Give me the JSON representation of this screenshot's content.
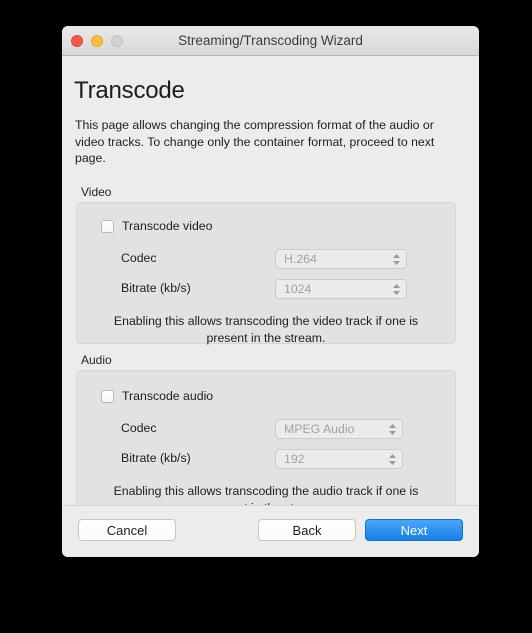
{
  "window": {
    "title": "Streaming/Transcoding Wizard",
    "controls": {
      "close": "close-button",
      "minimize": "minimize-button",
      "zoom": "zoom-button"
    }
  },
  "page": {
    "title": "Transcode",
    "description": "This page allows changing the compression format of the audio or video tracks. To change only the container format, proceed to next page."
  },
  "video": {
    "group_label": "Video",
    "checkbox_label": "Transcode video",
    "checked": false,
    "codec": {
      "label": "Codec",
      "value": "H.264"
    },
    "bitrate": {
      "label": "Bitrate (kb/s)",
      "value": "1024"
    },
    "hint": "Enabling this allows transcoding the video track if one is present in the stream."
  },
  "audio": {
    "group_label": "Audio",
    "checkbox_label": "Transcode audio",
    "checked": false,
    "codec": {
      "label": "Codec",
      "value": "MPEG Audio"
    },
    "bitrate": {
      "label": "Bitrate (kb/s)",
      "value": "192"
    },
    "hint": "Enabling this allows transcoding the audio track if one is present in the stream."
  },
  "footer": {
    "cancel_label": "Cancel",
    "back_label": "Back",
    "next_label": "Next"
  },
  "colors": {
    "accent": "#1580e9",
    "close": "#f9564c",
    "minimize": "#fbbf3f",
    "zoom_disabled": "#d2d2d2",
    "window_bg": "#ececec",
    "group_bg": "#e2e2e2"
  }
}
